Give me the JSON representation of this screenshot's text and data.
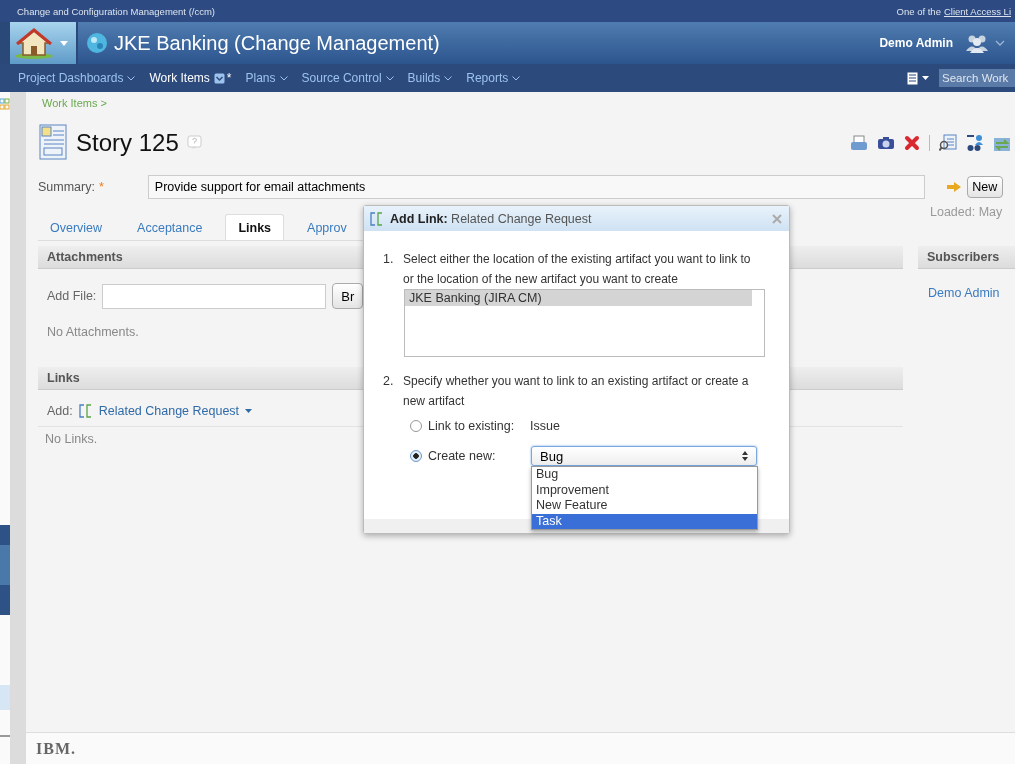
{
  "top_bar": {
    "title": "Change and Configuration Management (/ccm)",
    "notice": "One of the",
    "notice_link": "Client Access Li"
  },
  "banner": {
    "title": "JKE Banking (Change Management)",
    "user": "Demo Admin"
  },
  "nav": {
    "items": [
      {
        "label": "Project Dashboards",
        "selected": false
      },
      {
        "label": "Work Items",
        "selected": true,
        "suffix": "*"
      },
      {
        "label": "Plans",
        "selected": false
      },
      {
        "label": "Source Control",
        "selected": false
      },
      {
        "label": "Builds",
        "selected": false
      },
      {
        "label": "Reports",
        "selected": false
      }
    ],
    "search": {
      "placeholder": "Search Work"
    }
  },
  "breadcrumb": "Work Items >",
  "work_item": {
    "title": "Story 125",
    "summary_label": "Summary:",
    "required_mark": "*",
    "summary": "Provide support for email attachments",
    "next_button": "New",
    "loaded": "Loaded: May"
  },
  "tabs": [
    {
      "label": "Overview",
      "selected": false
    },
    {
      "label": "Acceptance",
      "selected": false
    },
    {
      "label": "Links",
      "selected": true
    },
    {
      "label": "Approv",
      "selected": false
    }
  ],
  "attachments": {
    "title": "Attachments",
    "add_file_label": "Add File:",
    "browse_button": "Br",
    "empty": "No Attachments."
  },
  "links": {
    "title": "Links",
    "add_label": "Add:",
    "link_type": "Related Change Request",
    "empty": "No Links."
  },
  "subscribers": {
    "title": "Subscribers",
    "items": [
      "Demo Admin"
    ]
  },
  "dialog": {
    "title_bold": "Add Link:",
    "title": "Related Change Request",
    "steps": [
      {
        "number": "1.",
        "text": "Select either the location of the existing artifact you want to link to or the location of the new artifact you want to create"
      },
      {
        "number": "2.",
        "text": "Specify whether you want to link to an existing artifact or create a new artifact"
      }
    ],
    "locations": [
      {
        "label": "JKE Banking (JIRA CM)",
        "selected": true
      }
    ],
    "options": [
      {
        "kind": "text",
        "label": "Link to existing:",
        "value": "Issue",
        "selected": false
      },
      {
        "kind": "select",
        "label": "Create new:",
        "value": "Bug",
        "selected": true
      }
    ],
    "dropdown": [
      {
        "label": "Bug",
        "selected": false
      },
      {
        "label": "Improvement",
        "selected": false
      },
      {
        "label": "New Feature",
        "selected": false
      },
      {
        "label": "Task",
        "selected": true
      }
    ]
  },
  "footer": {
    "logo": "IBM."
  }
}
